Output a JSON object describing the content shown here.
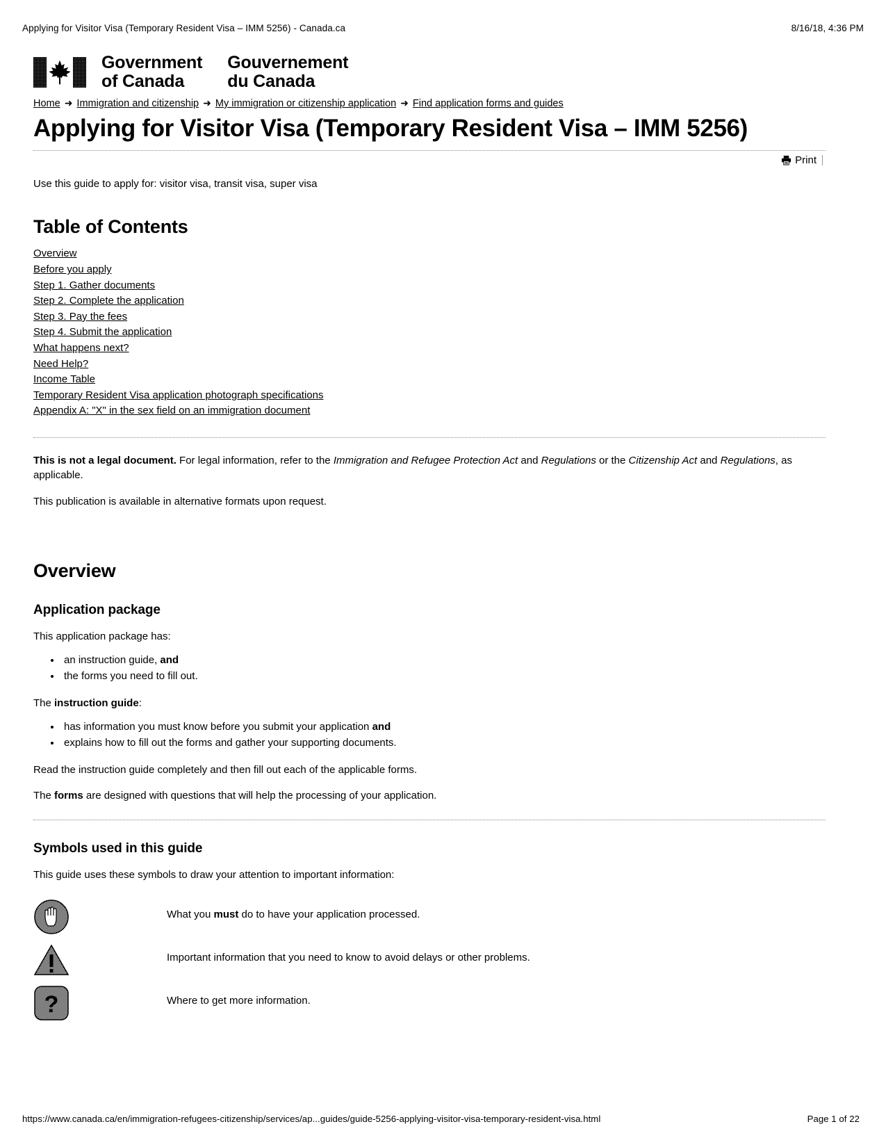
{
  "print_header": {
    "title": "Applying for Visitor Visa (Temporary Resident Visa – IMM 5256) - Canada.ca",
    "date": "8/16/18, 4:36 PM"
  },
  "print_footer": {
    "url": "https://www.canada.ca/en/immigration-refugees-citizenship/services/ap...guides/guide-5256-applying-visitor-visa-temporary-resident-visa.html",
    "page": "Page 1 of 22"
  },
  "signature": {
    "wordmark_en_line1": "Government",
    "wordmark_en_line2": "of Canada",
    "wordmark_fr_line1": "Gouvernement",
    "wordmark_fr_line2": "du Canada"
  },
  "breadcrumb": {
    "separator": "➜",
    "items": [
      {
        "label": "Home"
      },
      {
        "label": "Immigration and citizenship"
      },
      {
        "label": "My immigration or citizenship application"
      },
      {
        "label": "Find application forms and guides"
      }
    ]
  },
  "page_title": "Applying for Visitor Visa (Temporary Resident Visa – IMM 5256)",
  "print_button": {
    "label": "Print"
  },
  "intro": "Use this guide to apply for: visitor visa, transit visa, super visa",
  "toc": {
    "heading": "Table of Contents",
    "items": [
      {
        "label": "Overview"
      },
      {
        "label": "Before you apply"
      },
      {
        "label": "Step 1. Gather documents"
      },
      {
        "label": "Step 2. Complete the application"
      },
      {
        "label": "Step 3. Pay the fees"
      },
      {
        "label": "Step 4. Submit the application"
      },
      {
        "label": "What happens next?"
      },
      {
        "label": "Need Help?"
      },
      {
        "label": "Income Table"
      },
      {
        "label": "Temporary Resident Visa application photograph specifications"
      },
      {
        "label": "Appendix A: \"X\" in the sex field on an immigration document"
      }
    ]
  },
  "disclaimer": {
    "bold_lead": "This is not a legal document.",
    "text_1": " For legal information, refer to the ",
    "italic_1": "Immigration and Refugee Protection Act",
    "text_2": " and ",
    "italic_2": "Regulations",
    "text_3": " or the ",
    "italic_3": "Citizenship Act",
    "text_4": " and ",
    "italic_4": "Regulations",
    "text_5": ", as applicable.",
    "alt_formats": "This publication is available in alternative formats upon request."
  },
  "overview": {
    "heading": "Overview",
    "application_package": {
      "heading": "Application package",
      "intro": "This application package has:",
      "bullets": [
        {
          "text": "an instruction guide, ",
          "bold_tail": "and"
        },
        {
          "text": "the forms you need to fill out.",
          "bold_tail": ""
        }
      ],
      "guide_lead_plain": "The ",
      "guide_lead_bold": "instruction guide",
      "guide_lead_tail": ":",
      "guide_bullets": [
        {
          "text": "has information you must know before you submit your application ",
          "bold_tail": "and"
        },
        {
          "text": "explains how to fill out the forms and gather your supporting documents.",
          "bold_tail": ""
        }
      ],
      "read_note": "Read the instruction guide completely and then fill out each of the applicable forms.",
      "forms_lead_plain": "The ",
      "forms_lead_bold": "forms",
      "forms_lead_tail": " are designed with questions that will help the processing of your application."
    },
    "symbols": {
      "heading": "Symbols used in this guide",
      "intro": "This guide uses these symbols to draw your attention to important information:",
      "rows": [
        {
          "icon": "stop-hand-icon",
          "text_plain_1": "What you ",
          "text_bold": "must",
          "text_plain_2": " do to have your application processed."
        },
        {
          "icon": "warning-triangle-icon",
          "text_plain_1": "Important information that you need to know to avoid delays or other problems.",
          "text_bold": "",
          "text_plain_2": ""
        },
        {
          "icon": "question-mark-icon",
          "text_plain_1": "Where to get more information.",
          "text_bold": "",
          "text_plain_2": ""
        }
      ]
    }
  }
}
